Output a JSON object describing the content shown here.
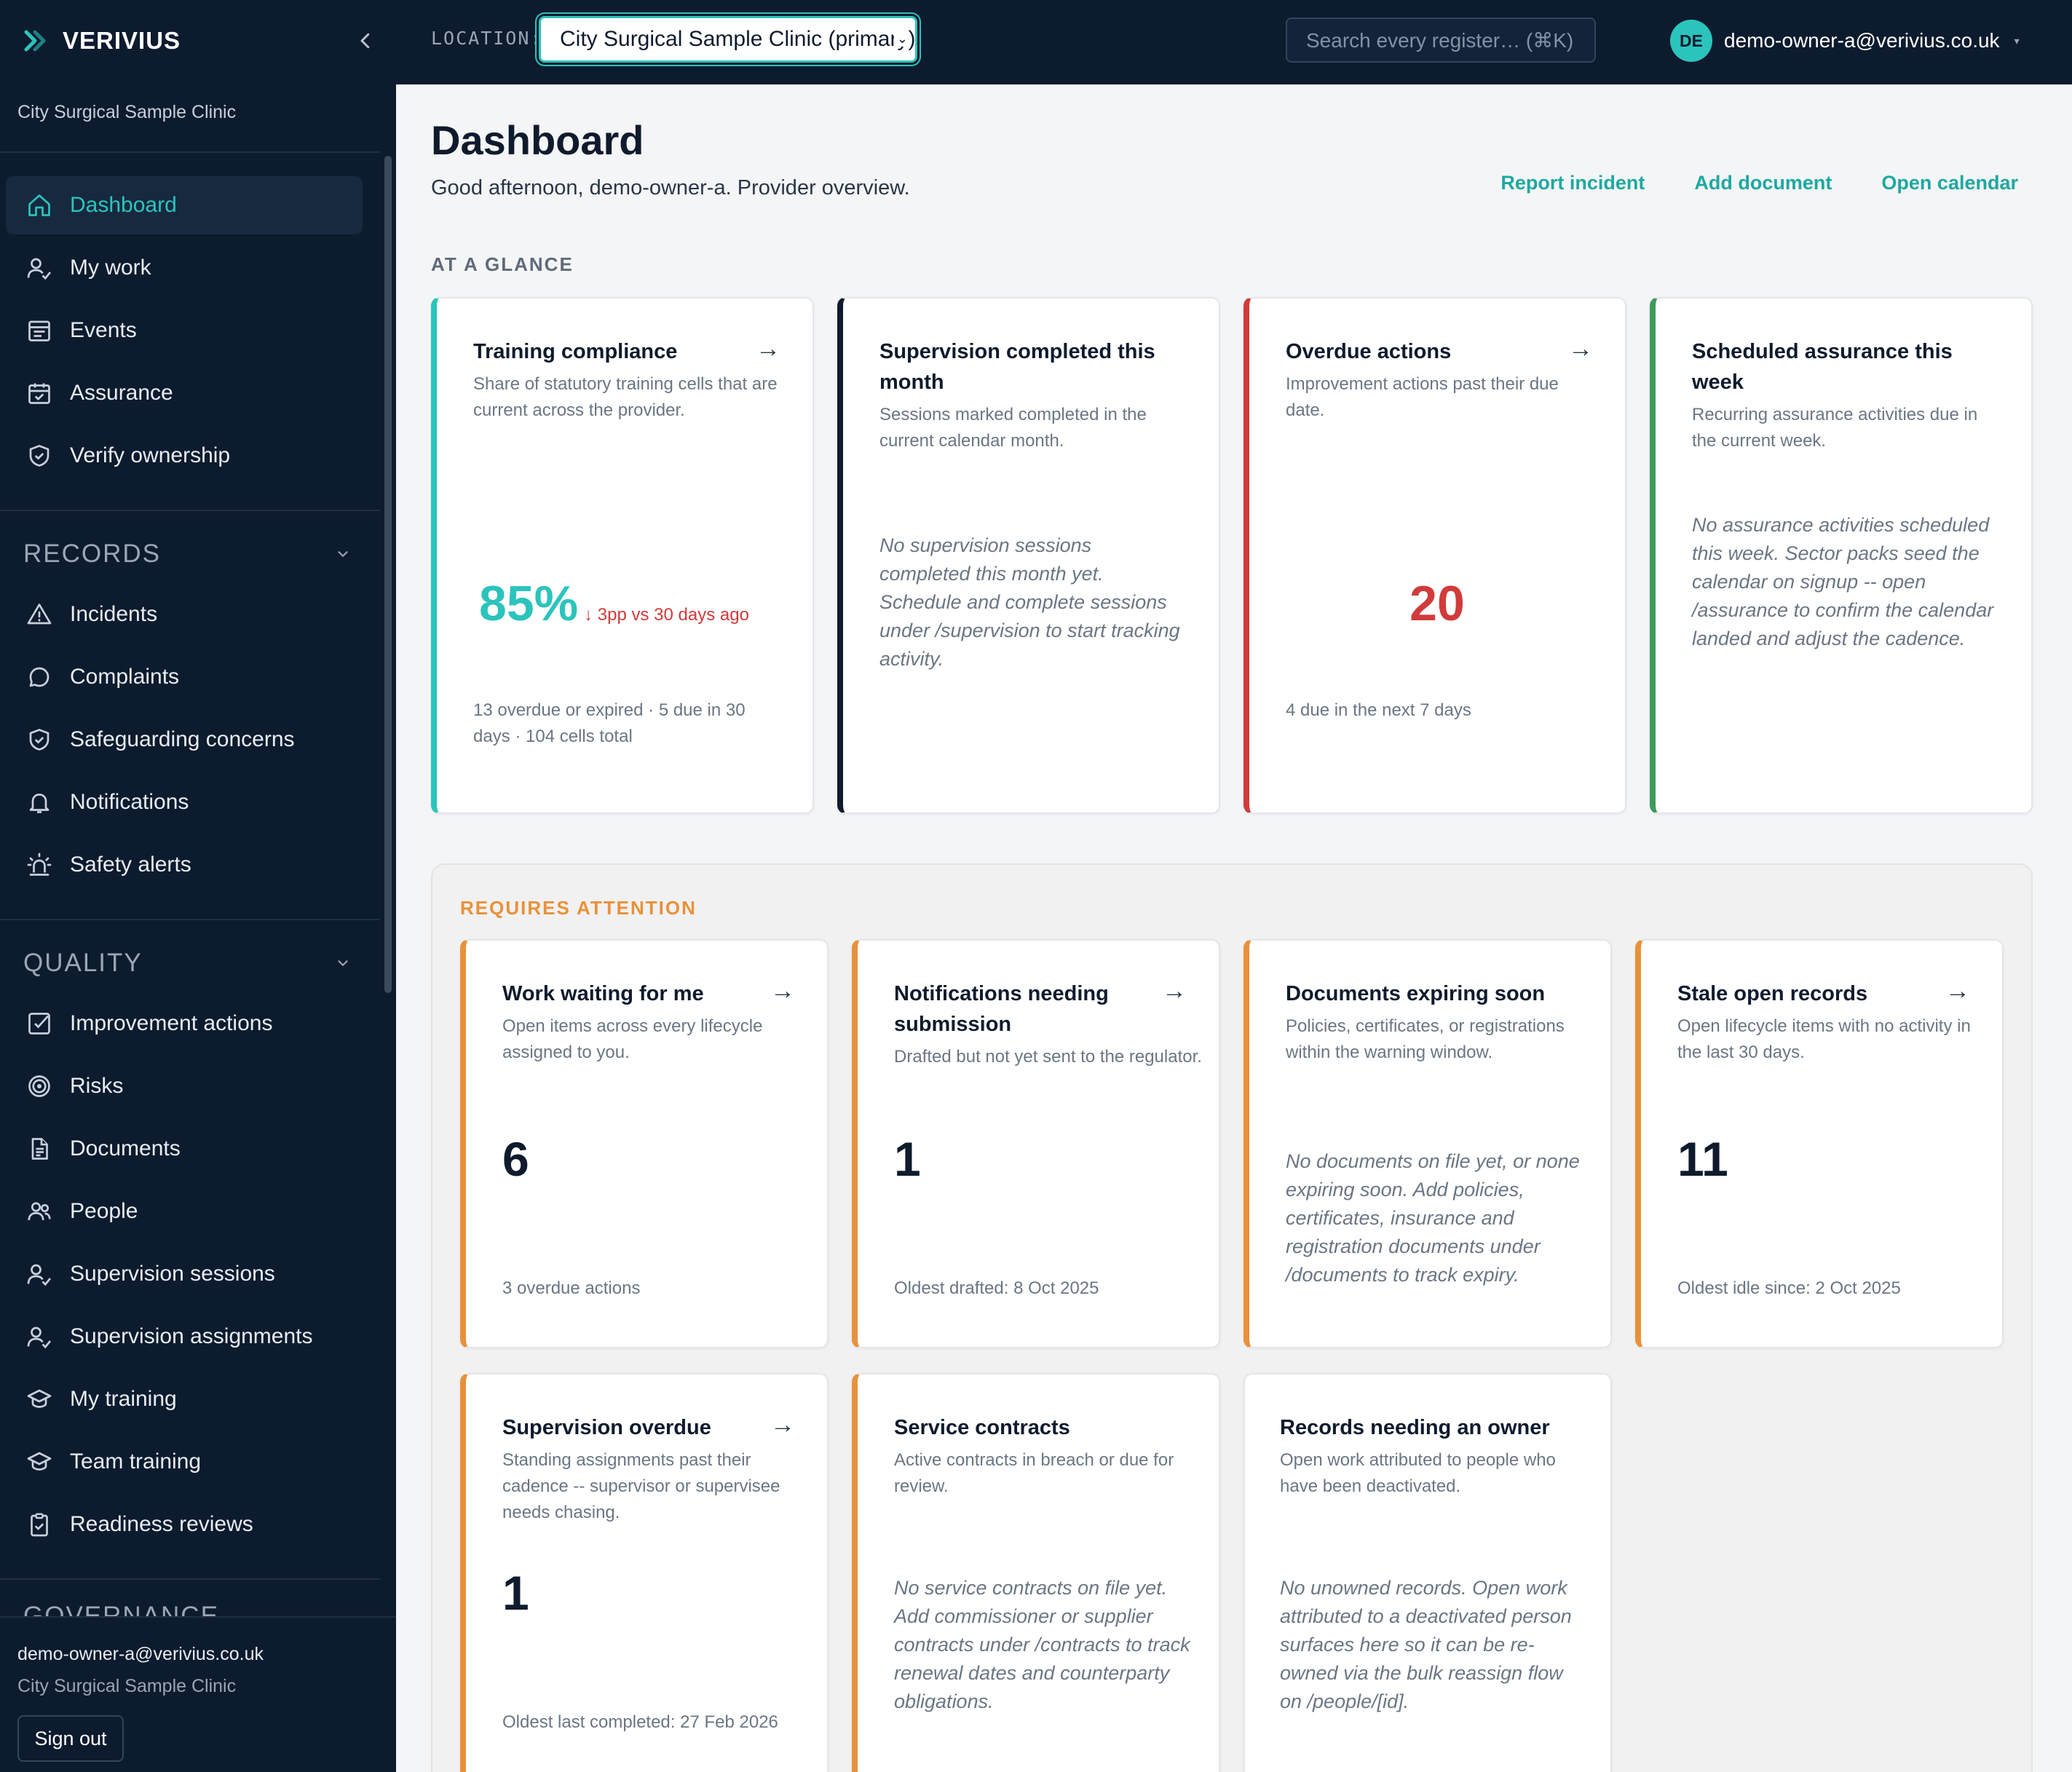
{
  "app": {
    "brand": "VERIVIUS",
    "org_name": "City Surgical Sample Clinic"
  },
  "sidebar": {
    "primary": [
      {
        "label": "Dashboard",
        "icon": "home-icon",
        "active": true
      },
      {
        "label": "My work",
        "icon": "user-check-icon"
      },
      {
        "label": "Events",
        "icon": "calendar-list-icon"
      },
      {
        "label": "Assurance",
        "icon": "calendar-check-icon"
      },
      {
        "label": "Verify ownership",
        "icon": "shield-check-icon"
      }
    ],
    "records_heading": "RECORDS",
    "records": [
      {
        "label": "Incidents",
        "icon": "warning-icon"
      },
      {
        "label": "Complaints",
        "icon": "message-icon"
      },
      {
        "label": "Safeguarding concerns",
        "icon": "shield-check-icon"
      },
      {
        "label": "Notifications",
        "icon": "bell-icon"
      },
      {
        "label": "Safety alerts",
        "icon": "siren-icon"
      }
    ],
    "quality_heading": "QUALITY",
    "quality": [
      {
        "label": "Improvement actions",
        "icon": "checkbox-icon"
      },
      {
        "label": "Risks",
        "icon": "target-icon"
      },
      {
        "label": "Documents",
        "icon": "document-icon"
      },
      {
        "label": "People",
        "icon": "people-icon"
      },
      {
        "label": "Supervision sessions",
        "icon": "user-check-icon"
      },
      {
        "label": "Supervision assignments",
        "icon": "user-check-icon"
      },
      {
        "label": "My training",
        "icon": "graduation-cap-icon"
      },
      {
        "label": "Team training",
        "icon": "graduation-cap-icon"
      },
      {
        "label": "Readiness reviews",
        "icon": "clipboard-check-icon"
      }
    ],
    "governance_heading": "GOVERNANCE",
    "footer": {
      "email": "demo-owner-a@verivius.co.uk",
      "org": "City Surgical Sample Clinic",
      "sign_out": "Sign out"
    }
  },
  "topbar": {
    "location_label": "LOCATION:",
    "location_value": "City Surgical Sample Clinic (primary)",
    "search_placeholder": "Search every register…  (⌘K)",
    "avatar_initials": "DE",
    "user_email": "demo-owner-a@verivius.co.uk"
  },
  "page": {
    "title": "Dashboard",
    "greeting": "Good afternoon, demo-owner-a. Provider overview.",
    "actions": [
      "Report incident",
      "Add document",
      "Open calendar"
    ]
  },
  "glance": {
    "label": "AT A GLANCE",
    "training": {
      "title": "Training compliance",
      "desc": "Share of statutory training cells that are current across the provider.",
      "value": "85%",
      "delta": "↓ 3pp vs 30 days ago",
      "foot": "13 overdue or expired · 5 due in 30 days · 104 cells total"
    },
    "supervision": {
      "title": "Supervision completed this month",
      "desc": "Sessions marked completed in the current calendar month.",
      "empty": "No supervision sessions completed this month yet. Schedule and complete sessions under /supervision to start tracking activity."
    },
    "overdue": {
      "title": "Overdue actions",
      "desc": "Improvement actions past their due date.",
      "value": "20",
      "foot": "4 due in the next 7 days"
    },
    "assurance": {
      "title": "Scheduled assurance this week",
      "desc": "Recurring assurance activities due in the current week.",
      "empty": "No assurance activities scheduled this week. Sector packs seed the calendar on signup -- open /assurance to confirm the calendar landed and adjust the cadence."
    }
  },
  "attention": {
    "label": "REQUIRES ATTENTION",
    "work": {
      "title": "Work waiting for me",
      "desc": "Open items across every lifecycle assigned to you.",
      "value": "6",
      "foot": "3 overdue actions"
    },
    "notifications": {
      "title": "Notifications needing submission",
      "desc": "Drafted but not yet sent to the regulator.",
      "value": "1",
      "foot": "Oldest drafted: 8 Oct 2025"
    },
    "documents": {
      "title": "Documents expiring soon",
      "desc": "Policies, certificates, or registrations within the warning window.",
      "empty": "No documents on file yet, or none expiring soon. Add policies, certificates, insurance and registration documents under /documents to track expiry."
    },
    "stale": {
      "title": "Stale open records",
      "desc": "Open lifecycle items with no activity in the last 30 days.",
      "value": "11",
      "foot": "Oldest idle since: 2 Oct 2025"
    },
    "supervision_overdue": {
      "title": "Supervision overdue",
      "desc": "Standing assignments past their cadence -- supervisor or supervisee needs chasing.",
      "value": "1",
      "foot": "Oldest last completed: 27 Feb 2026"
    },
    "contracts": {
      "title": "Service contracts",
      "desc": "Active contracts in breach or due for review.",
      "empty": "No service contracts on file yet. Add commissioner or supplier contracts under /contracts to track renewal dates and counterparty obligations."
    },
    "owner": {
      "title": "Records needing an owner",
      "desc": "Open work attributed to people who have been deactivated.",
      "empty": "No unowned records. Open work attributed to a deactivated person surfaces here so it can be re-owned via the bulk reassign flow on /people/[id]."
    }
  },
  "colors": {
    "sidebar_bg": "#0d1b2e",
    "accent_teal": "#2bc4bc",
    "danger_red": "#d13b3b",
    "success_green": "#3f9a5c",
    "warning_orange": "#e8913a",
    "navy_border": "#0f1b2d"
  }
}
